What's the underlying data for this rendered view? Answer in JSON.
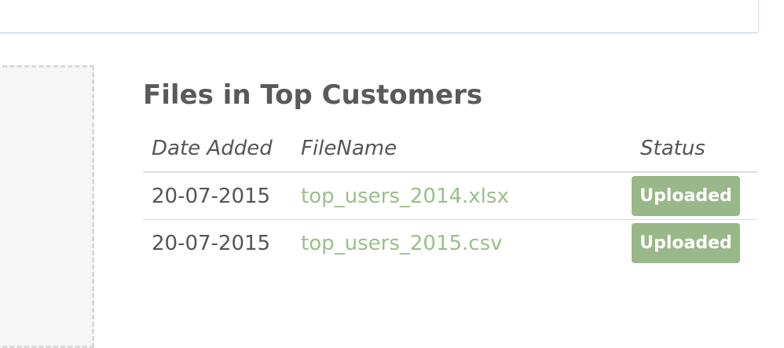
{
  "section": {
    "title": "Files in Top Customers"
  },
  "table": {
    "headers": {
      "date_added": "Date Added",
      "filename": "FileName",
      "status": "Status"
    },
    "rows": [
      {
        "date_added": "20-07-2015",
        "filename": "top_users_2014.xlsx",
        "status": "Uploaded"
      },
      {
        "date_added": "20-07-2015",
        "filename": "top_users_2015.csv",
        "status": "Uploaded"
      }
    ]
  },
  "colors": {
    "link": "#9cbe8b",
    "status_badge": "#99b889",
    "text": "#555555",
    "title": "#5a5a5a"
  }
}
